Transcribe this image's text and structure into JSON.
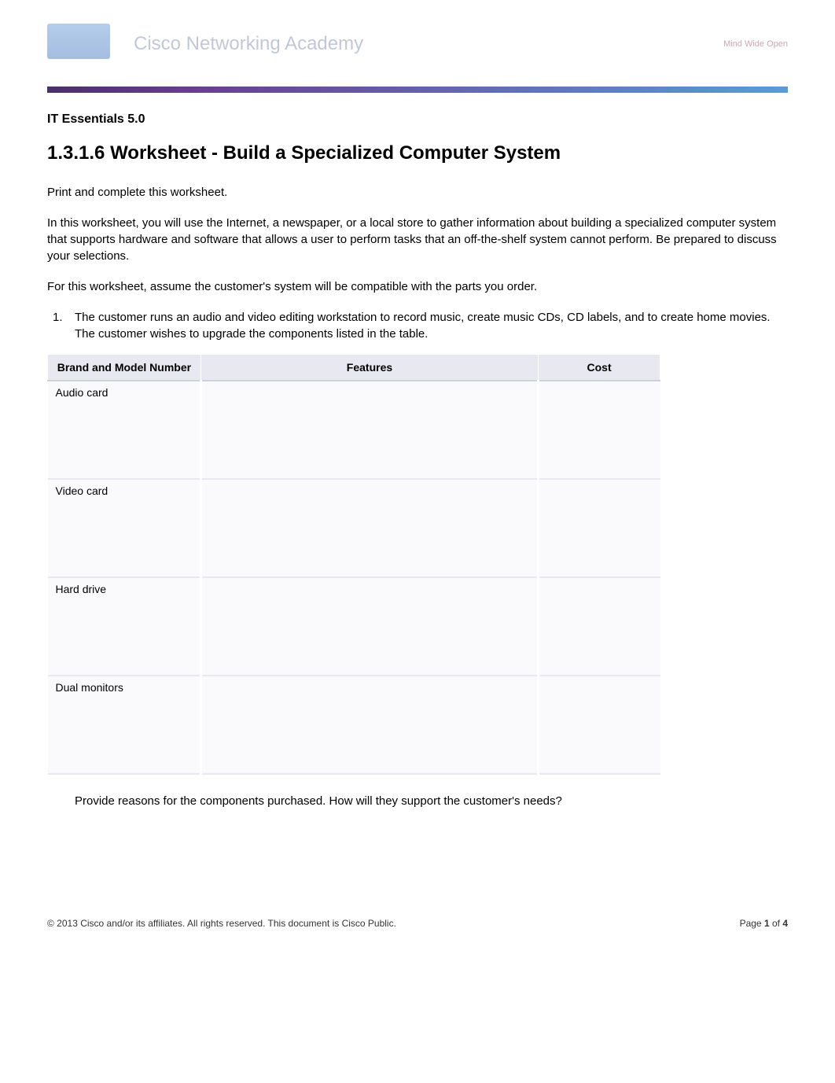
{
  "header": {
    "academy_text": "Cisco Networking Academy",
    "tagline": "Mind Wide Open"
  },
  "course": {
    "title": "IT Essentials 5.0"
  },
  "worksheet": {
    "title": "1.3.1.6 Worksheet - Build a Specialized Computer System",
    "instructions": [
      "Print and complete this worksheet.",
      "In this worksheet, you will use the Internet, a newspaper, or a local store to gather information about building a specialized computer system that supports hardware and software that allows a user to perform tasks that an off-the-shelf system cannot perform. Be prepared to discuss your selections.",
      "For this worksheet, assume the customer's system will be compatible with the parts you order."
    ],
    "item_number": "1.",
    "item_text": "The customer runs an audio and video editing workstation to record music, create music CDs, CD labels, and to create home movies. The customer wishes to upgrade the components listed in the table.",
    "question": "Provide reasons for the components purchased. How will they support the customer's needs?"
  },
  "table": {
    "headers": {
      "col1": "Brand and Model Number",
      "col2": "Features",
      "col3": "Cost"
    },
    "rows": [
      {
        "label": "Audio card",
        "features": "",
        "cost": ""
      },
      {
        "label": "Video card",
        "features": "",
        "cost": ""
      },
      {
        "label": "Hard drive",
        "features": "",
        "cost": ""
      },
      {
        "label": "Dual monitors",
        "features": "",
        "cost": ""
      }
    ]
  },
  "footer": {
    "copyright": "© 2013 Cisco and/or its affiliates. All rights reserved. This document is Cisco Public.",
    "page_label": "Page ",
    "page_current": "1",
    "page_of": " of ",
    "page_total": "4"
  }
}
